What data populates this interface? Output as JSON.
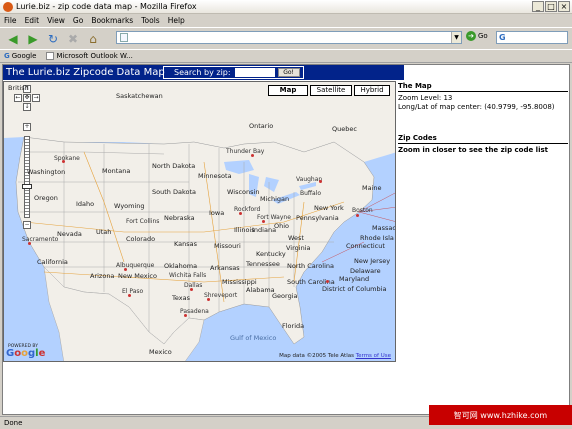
{
  "window": {
    "title": "Lurie.biz - zip code data map - Mozilla Firefox",
    "buttons": {
      "minimize": "_",
      "maximize": "□",
      "close": "×"
    }
  },
  "menu": [
    "File",
    "Edit",
    "View",
    "Go",
    "Bookmarks",
    "Tools",
    "Help"
  ],
  "toolbar": {
    "go_label": "Go",
    "url_value": ""
  },
  "bookmarks": [
    {
      "label": "Google"
    },
    {
      "label": "Microsoft Outlook W..."
    }
  ],
  "page": {
    "title": "The Lurie.biz Zipcode Data Map",
    "search_label": "Search by zip:",
    "search_value": "",
    "go_button": "Go!"
  },
  "map": {
    "types": [
      "Map",
      "Satellite",
      "Hybrid"
    ],
    "active_type": "Map",
    "copyright": "Map data ©2005 Tele Atlas",
    "terms": "Terms of Use",
    "powered_by": "POWERED BY",
    "logo": "Google",
    "labels": {
      "british": "British",
      "saskatchewan": "Saskatchewan",
      "ontario": "Ontario",
      "quebec": "Quebec",
      "thunder_bay": "Thunder Bay",
      "spokane": "Spokane",
      "washington": "Washington",
      "montana": "Montana",
      "north_dakota": "North Dakota",
      "minnesota": "Minnesota",
      "maine": "Maine",
      "oregon": "Oregon",
      "idaho": "Idaho",
      "south_dakota": "South Dakota",
      "wisconsin": "Wisconsin",
      "michigan": "Michigan",
      "vaughan": "Vaughan",
      "buffalo": "Buffalo",
      "wyoming": "Wyoming",
      "iowa": "Iowa",
      "new_york": "New York",
      "boston": "Boston",
      "nebraska": "Nebraska",
      "fort_collins": "Fort Collins",
      "rockford": "Rockford",
      "fort_wayne": "Fort Wayne",
      "ohio": "Ohio",
      "pennsylvania": "Pennsylvania",
      "massachusetts": "Massac",
      "nevada": "Nevada",
      "utah": "Utah",
      "colorado": "Colorado",
      "illinois": "Illinois",
      "indiana": "Indiana",
      "rhode_island": "Rhode Isla",
      "connecticut": "Connecticut",
      "sacramento": "Sacramento",
      "kansas": "Kansas",
      "missouri": "Missouri",
      "west_virginia": "West",
      "virginia": "Virginia",
      "new_jersey": "New Jersey",
      "kentucky": "Kentucky",
      "delaware": "Delaware",
      "maryland": "Maryland",
      "district_of_columbia": "District of Columbia",
      "california": "California",
      "albuquerque": "Albuquerque",
      "arizona": "Arizona",
      "new_mexico": "New Mexico",
      "wichita_falls": "Wichita Falls",
      "oklahoma": "Oklahoma",
      "arkansas": "Arkansas",
      "tennessee": "Tennessee",
      "north_carolina": "North Carolina",
      "el_paso": "El Paso",
      "texas": "Texas",
      "dallas": "Dallas",
      "shreveport": "Shreveport",
      "mississippi": "Mississippi",
      "alabama": "Alabama",
      "georgia": "Georgia",
      "south_carolina": "South Carolina",
      "mexico": "Mexico",
      "pasadena": "Pasadena",
      "gulf_of_mexico": "Gulf of Mexico",
      "florida": "Florida"
    }
  },
  "sidebar": {
    "map_heading": "The Map",
    "zoom": "Zoom Level: 13",
    "longlat": "Long/Lat of map center: (40.9799, -95.8008)",
    "zip_heading": "Zip Codes",
    "zip_hint": "Zoom in closer to see the zip code list"
  },
  "status": "Done",
  "watermark": "智可网 www.hzhike.com",
  "colors": {
    "header_bg": "#02238a",
    "land": "#f2efe9",
    "water": "#b3d1ff"
  }
}
